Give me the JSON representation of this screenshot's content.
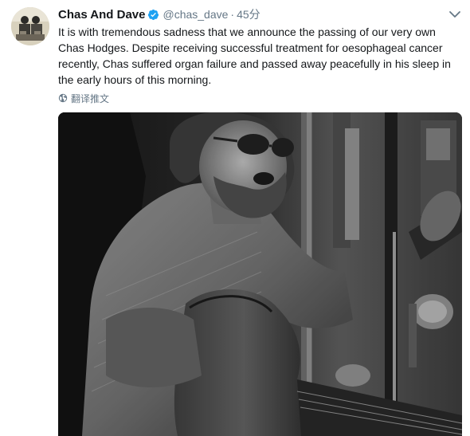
{
  "tweet": {
    "display_name": "Chas And Dave",
    "handle": "@chas_dave",
    "separator": "·",
    "timestamp": "45分",
    "text": "It is with tremendous sadness that we announce the passing of our very own Chas Hodges. Despite receiving successful treatment for oesophageal cancer recently, Chas suffered organ failure and passed away peacefully in his sleep in the early hours of this morning.",
    "translate_label": "翻译推文"
  },
  "icons": {
    "verified": "verified-badge-icon",
    "caret": "chevron-down-icon",
    "globe": "globe-icon"
  },
  "colors": {
    "verified_blue": "#1da1f2",
    "secondary_text": "#657786",
    "primary_text": "#14171a"
  }
}
